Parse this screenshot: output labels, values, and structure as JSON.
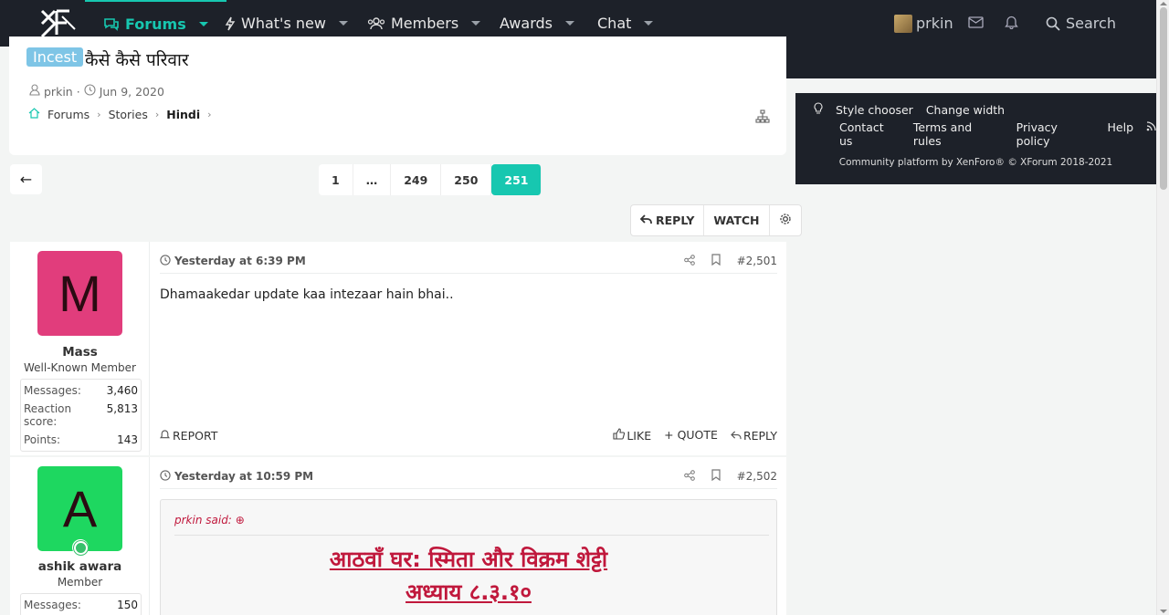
{
  "nav": {
    "items": [
      {
        "label": "Forums",
        "icon": "chat-bubbles-icon"
      },
      {
        "label": "What's new",
        "icon": "bolt-icon"
      },
      {
        "label": "Members",
        "icon": "users-icon"
      },
      {
        "label": "Awards"
      },
      {
        "label": "Chat"
      }
    ],
    "username": "prkin",
    "search_label": "Search"
  },
  "thread": {
    "prefix": "Incest",
    "title": "कैसे कैसे परिवार",
    "author": "prkin",
    "date": "Jun 9, 2020",
    "breadcrumbs": [
      "Forums",
      "Stories",
      "Hindi"
    ]
  },
  "pagination": {
    "back": "←",
    "pages": [
      "1",
      "…",
      "249",
      "250",
      "251"
    ],
    "current": "251"
  },
  "thread_actions": {
    "reply": "REPLY",
    "watch": "WATCH"
  },
  "posts": [
    {
      "avatar_letter": "M",
      "avatar_color": "#e13d7c",
      "name": "Mass",
      "title": "Well-Known Member",
      "stats": [
        {
          "k": "Messages:",
          "v": "3,460"
        },
        {
          "k": "Reaction score:",
          "v": "5,813"
        },
        {
          "k": "Points:",
          "v": "143"
        }
      ],
      "date": "Yesterday at 6:39 PM",
      "number": "#2,501",
      "body": "Dhamaakedar update kaa intezaar hain bhai..",
      "report": "REPORT",
      "like": "LIKE",
      "quote": "QUOTE",
      "reply": "REPLY"
    },
    {
      "avatar_letter": "A",
      "avatar_color": "#1ed760",
      "name": "ashik awara",
      "title": "Member",
      "stats": [
        {
          "k": "Messages:",
          "v": "150"
        }
      ],
      "date": "Yesterday at 10:59 PM",
      "number": "#2,502",
      "quote_author": "prkin said:",
      "quote_lines": [
        "आठवाँ घर: स्मिता और विक्रम शेट्टी",
        "अध्याय ८.३.१०",
        "………."
      ]
    }
  ],
  "footer": {
    "style_chooser": "Style chooser",
    "change_width": "Change width",
    "contact": "Contact us",
    "terms": "Terms and rules",
    "privacy": "Privacy policy",
    "help": "Help",
    "copyright": "Community platform by XenForo® © XForum 2018-2021"
  },
  "colors": {
    "accent": "#17c7b0",
    "nav_bg": "#1d2129",
    "quote_red": "#c0183c"
  }
}
